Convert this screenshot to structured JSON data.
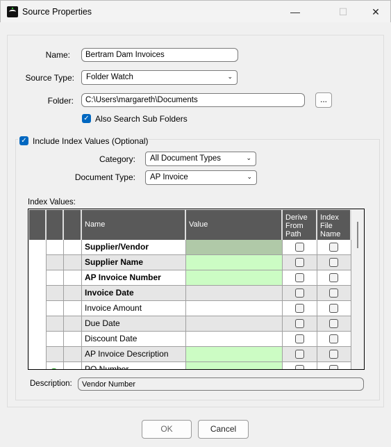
{
  "window": {
    "title": "Source Properties",
    "minimize": "—",
    "maximize": "☐",
    "close": "✕"
  },
  "form": {
    "name_label": "Name:",
    "name_value": "Bertram Dam Invoices",
    "source_type_label": "Source Type:",
    "source_type_value": "Folder Watch",
    "folder_label": "Folder:",
    "folder_value": "C:\\Users\\margareth\\Documents",
    "browse_label": "...",
    "subfolders_label": "Also Search Sub Folders",
    "subfolders_checked": true,
    "include_index_label": "Include Index Values (Optional)",
    "include_index_checked": true,
    "category_label": "Category:",
    "category_value": "All Document Types",
    "doctype_label": "Document Type:",
    "doctype_value": "AP Invoice",
    "index_values_label": "Index Values:",
    "description_label": "Description:",
    "description_value": "Vendor Number"
  },
  "grid": {
    "headers": {
      "name": "Name",
      "value": "Value",
      "derive": "Derive From Path",
      "index": "Index File Name"
    },
    "rows": [
      {
        "name": "Supplier/Vendor",
        "bold": true,
        "value_color": "#b0c9a8",
        "selected": true
      },
      {
        "name": "Supplier Name",
        "bold": true,
        "value_color": "#ccfcc4"
      },
      {
        "name": "AP Invoice Number",
        "bold": true,
        "value_color": "#ccfcc4"
      },
      {
        "name": "Invoice Date",
        "bold": true,
        "value_color": ""
      },
      {
        "name": "Invoice Amount",
        "bold": false,
        "value_color": ""
      },
      {
        "name": "Due Date",
        "bold": false,
        "value_color": ""
      },
      {
        "name": "Discount Date",
        "bold": false,
        "value_color": ""
      },
      {
        "name": "AP Invoice Description",
        "bold": false,
        "value_color": "#ccfcc4"
      },
      {
        "name": "PO Number",
        "bold": false,
        "value_color": "#ccfcc4",
        "icon": "add-icon"
      }
    ]
  },
  "footer": {
    "ok": "OK",
    "cancel": "Cancel"
  }
}
